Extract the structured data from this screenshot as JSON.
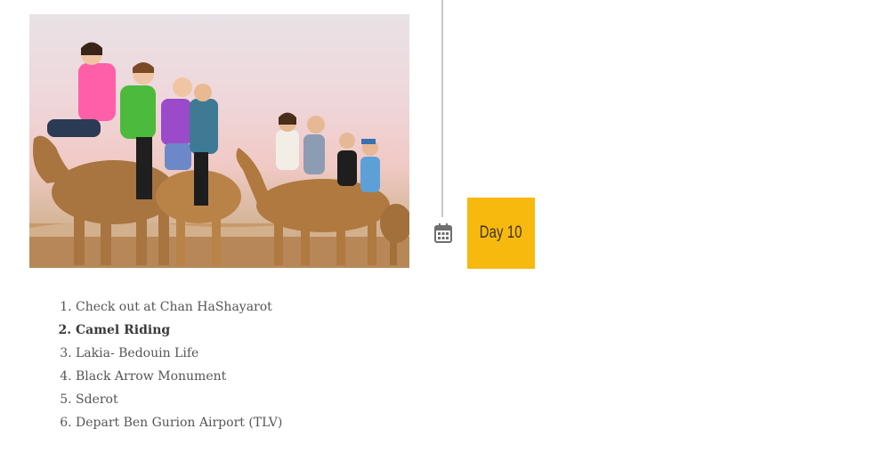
{
  "photo": {
    "alt": "Group riding camels in the desert"
  },
  "timeline": {
    "icon": "calendar-icon",
    "day_label": "Day 10",
    "accent_color": "#f8b90e"
  },
  "itinerary": {
    "items": [
      {
        "label": "Check out at Chan HaShayarot",
        "bold": false
      },
      {
        "label": "Camel Riding",
        "bold": true
      },
      {
        "label": "Lakia- Bedouin Life",
        "bold": false
      },
      {
        "label": "Black Arrow Monument",
        "bold": false
      },
      {
        "label": "Sderot",
        "bold": false
      },
      {
        "label": "Depart Ben Gurion Airport (TLV)",
        "bold": false
      }
    ]
  }
}
